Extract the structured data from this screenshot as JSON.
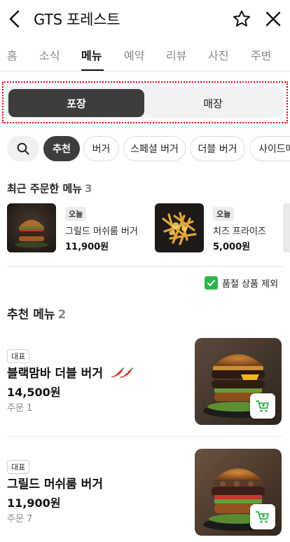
{
  "header": {
    "title": "GTS 포레스트",
    "icons": {
      "back": "back-arrow-icon",
      "favorite": "star-icon",
      "close": "close-icon"
    }
  },
  "tabs": [
    {
      "label": "홈",
      "active": false
    },
    {
      "label": "소식",
      "active": false
    },
    {
      "label": "메뉴",
      "active": true
    },
    {
      "label": "예약",
      "active": false
    },
    {
      "label": "리뷰",
      "active": false
    },
    {
      "label": "사진",
      "active": false
    },
    {
      "label": "주변",
      "active": false
    }
  ],
  "order_type": {
    "takeout": "포장",
    "dine_in": "매장",
    "selected": "포장"
  },
  "chips": {
    "search_icon": "search-icon",
    "items": [
      {
        "label": "추천",
        "active": true
      },
      {
        "label": "버거",
        "active": false
      },
      {
        "label": "스페셜 버거",
        "active": false
      },
      {
        "label": "더블 버거",
        "active": false
      },
      {
        "label": "사이드메뉴",
        "active": false
      }
    ]
  },
  "recent_orders": {
    "title": "최근 주문한 메뉴",
    "count": "3",
    "items": [
      {
        "badge": "오늘",
        "name": "그릴드 머쉬룸 버거",
        "price": "11,900원"
      },
      {
        "badge": "오늘",
        "name": "치즈 프라이즈",
        "price": "5,000원"
      }
    ]
  },
  "filter": {
    "exclude_soldout_label": "품절 상품 제외",
    "checked": true,
    "icon": "checkmark-icon"
  },
  "recommended": {
    "title": "추천 메뉴",
    "count": "2",
    "items": [
      {
        "badge": "대표",
        "name": "블랙맘바 더블 버거",
        "spicy_icon": "chili-pepper-icon",
        "price": "14,500원",
        "orders": "주문 1",
        "cart_icon": "cart-icon"
      },
      {
        "badge": "대표",
        "name": "그릴드 머쉬룸 버거",
        "price": "11,900원",
        "orders": "주문 7",
        "cart_icon": "cart-icon"
      }
    ]
  },
  "colors": {
    "accent_green": "#2db44a",
    "dark_pill": "#3d3d3d",
    "highlight_border": "#e0001a"
  }
}
